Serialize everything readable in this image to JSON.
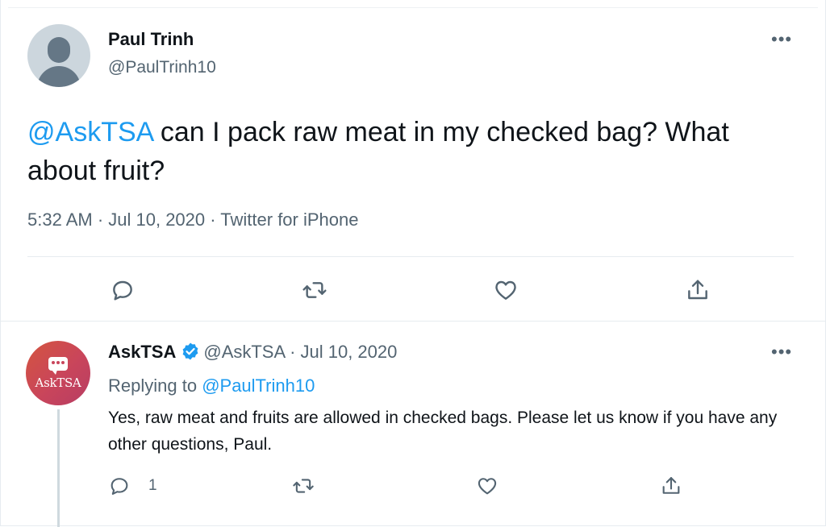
{
  "tweet": {
    "author_name": "Paul Trinh",
    "author_handle": "@PaulTrinh10",
    "more_label": "•••",
    "text_mention": "@AskTSA",
    "text_body": " can I pack raw meat in my checked bag? What about fruit?",
    "meta": "5:32 AM · Jul 10, 2020 · Twitter for iPhone",
    "actions": [
      "reply-icon",
      "retweet-icon",
      "like-icon",
      "share-icon"
    ]
  },
  "reply": {
    "avatar_label": "AskTSA",
    "author_name": "AskTSA",
    "author_handle": "@AskTSA",
    "date": " · Jul 10, 2020",
    "more_label": "•••",
    "replying_prefix": "Replying to ",
    "replying_mention": "@PaulTrinh10",
    "text": "Yes, raw meat and fruits are allowed in checked bags. Please let us know if you have any other questions, Paul.",
    "reply_count": "1",
    "actions": [
      "reply-icon",
      "retweet-icon",
      "like-icon",
      "share-icon"
    ]
  },
  "colors": {
    "link": "#1d9bf0",
    "secondary_text": "#536471",
    "primary_text": "#0f1419",
    "divider": "#e6ecf0",
    "verified": "#1d9bf0"
  }
}
